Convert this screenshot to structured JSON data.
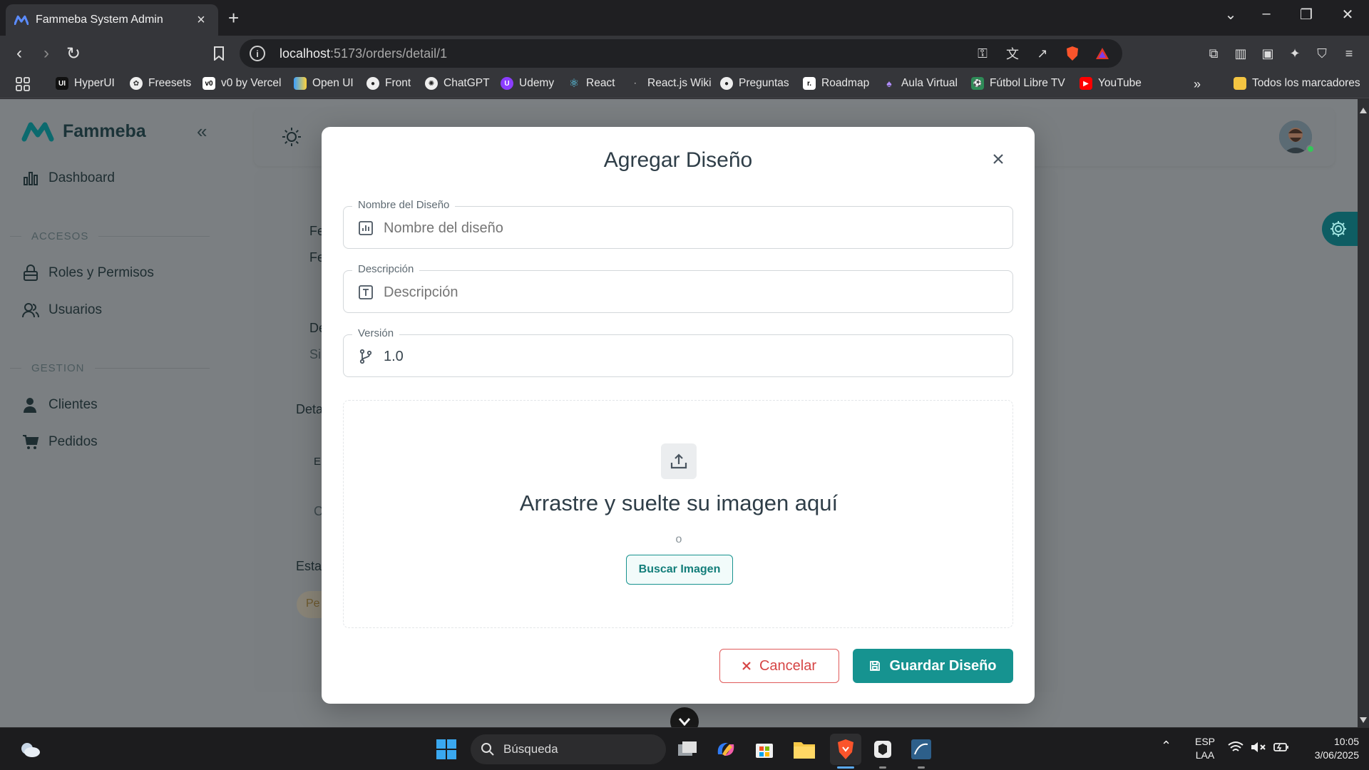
{
  "browser": {
    "tab_title": "Fammeba System Admin",
    "url_host": "localhost",
    "url_path": ":5173/orders/detail/1",
    "bookmarks": [
      {
        "label": "HyperUI",
        "icon": "hyperui-icon",
        "color": "#111111"
      },
      {
        "label": "Freesets",
        "icon": "freesets-icon",
        "color": "#444444"
      },
      {
        "label": "v0 by Vercel",
        "icon": "v0-icon",
        "color": "#000000"
      },
      {
        "label": "Open UI",
        "icon": "openui-icon",
        "color": "#3aa0ff"
      },
      {
        "label": "Front",
        "icon": "github-icon",
        "color": "#222222"
      },
      {
        "label": "ChatGPT",
        "icon": "chatgpt-icon",
        "color": "#555555"
      },
      {
        "label": "Udemy",
        "icon": "udemy-icon",
        "color": "#8b3dff"
      },
      {
        "label": "React",
        "icon": "react-icon",
        "color": "#2d3b45"
      },
      {
        "label": "React.js Wiki",
        "icon": "dot-icon",
        "color": "#35363a"
      },
      {
        "label": "Preguntas",
        "icon": "github-icon",
        "color": "#222222"
      },
      {
        "label": "Roadmap",
        "icon": "roadmap-icon",
        "color": "#000000"
      },
      {
        "label": "Aula Virtual",
        "icon": "aula-icon",
        "color": "#6a5acd"
      },
      {
        "label": "Fútbol Libre TV",
        "icon": "futbol-icon",
        "color": "#2e8b57"
      },
      {
        "label": "YouTube",
        "icon": "youtube-icon",
        "color": "#ff0000"
      }
    ],
    "all_bookmarks": "Todos los marcadores"
  },
  "sidebar": {
    "brand": "Fammeba",
    "items_main": [
      {
        "label": "Dashboard",
        "icon": "chart-icon"
      }
    ],
    "section_access": "ACCESOS",
    "items_access": [
      {
        "label": "Roles y Permisos",
        "icon": "lock-icon"
      },
      {
        "label": "Usuarios",
        "icon": "users-icon"
      }
    ],
    "section_manage": "GESTION",
    "items_manage": [
      {
        "label": "Clientes",
        "icon": "user-icon"
      },
      {
        "label": "Pedidos",
        "icon": "cart-icon"
      }
    ]
  },
  "background": {
    "frag1": "Fe",
    "frag2": "Fe",
    "frag3": "De",
    "frag4": "Si",
    "frag5": "Deta",
    "frag6": "E",
    "frag7": "C",
    "frag8": "Esta",
    "frag9": "Pe"
  },
  "modal": {
    "title": "Agregar Diseño",
    "name_label": "Nombre del Diseño",
    "name_placeholder": "Nombre del diseño",
    "desc_label": "Descripción",
    "desc_placeholder": "Descripción",
    "version_label": "Versión",
    "version_value": "1.0",
    "drop_title": "Arrastre y suelte su imagen aquí",
    "drop_or": "o",
    "browse_label": "Buscar Imagen",
    "cancel_label": "Cancelar",
    "save_label": "Guardar Diseño"
  },
  "taskbar": {
    "search_placeholder": "Búsqueda",
    "lang1": "ESP",
    "lang2": "LAA",
    "time": "10:05",
    "date": "3/06/2025"
  },
  "colors": {
    "accent": "#169390",
    "danger": "#d64545",
    "overlay": "#7b7f82"
  }
}
